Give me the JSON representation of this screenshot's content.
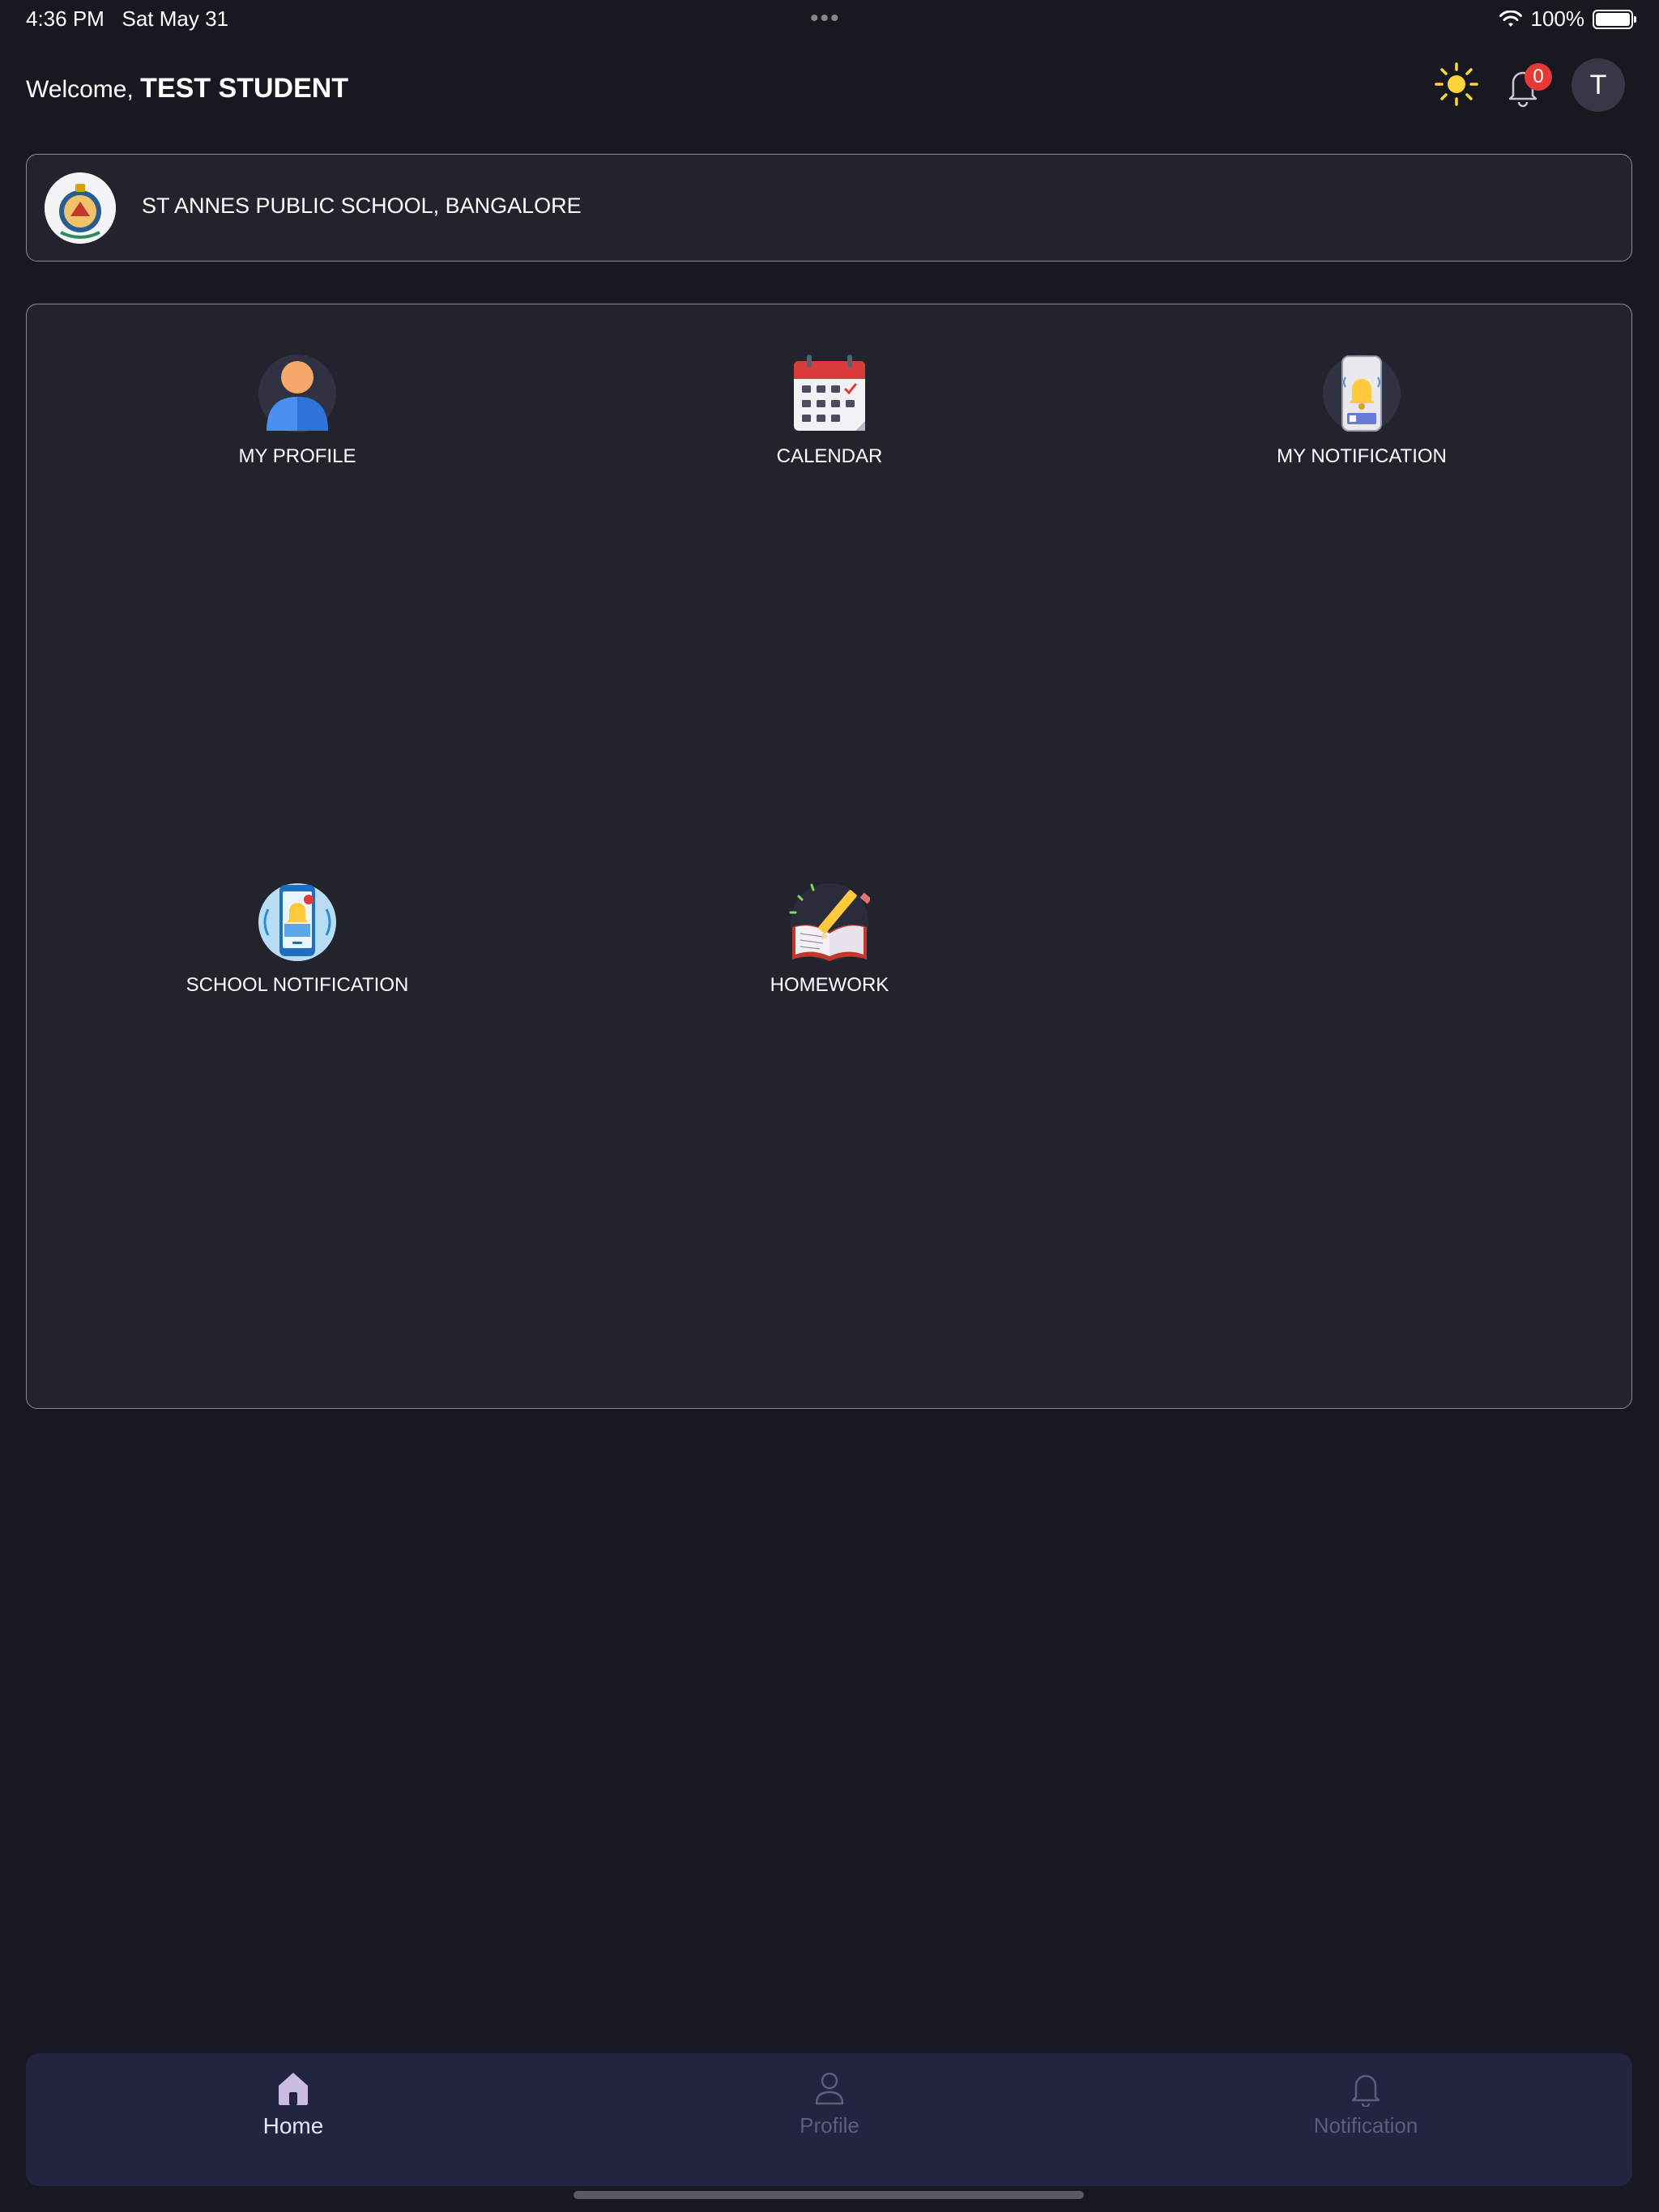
{
  "status_bar": {
    "time": "4:36 PM",
    "date": "Sat May 31",
    "battery": "100%",
    "battery_level": 1.0
  },
  "header": {
    "welcome_prefix": "Welcome,",
    "user_name": "TEST STUDENT",
    "notification_count": "0",
    "avatar_initial": "T"
  },
  "school": {
    "name": "ST ANNES PUBLIC SCHOOL, BANGALORE"
  },
  "menu": [
    {
      "label": "MY PROFILE",
      "icon": "profile-icon"
    },
    {
      "label": "CALENDAR",
      "icon": "calendar-icon"
    },
    {
      "label": "MY NOTIFICATION",
      "icon": "phone-bell-icon"
    },
    {
      "label": "SCHOOL NOTIFICATION",
      "icon": "school-notification-icon"
    },
    {
      "label": "HOMEWORK",
      "icon": "homework-icon"
    }
  ],
  "tabs": [
    {
      "label": "Home",
      "icon": "home-icon",
      "active": true
    },
    {
      "label": "Profile",
      "icon": "person-icon",
      "active": false
    },
    {
      "label": "Notification",
      "icon": "bell-icon",
      "active": false
    }
  ],
  "colors": {
    "background": "#181820",
    "card": "#22232c",
    "tabbar": "#222440",
    "badge": "#e53935",
    "sun": "#ffd43b"
  }
}
